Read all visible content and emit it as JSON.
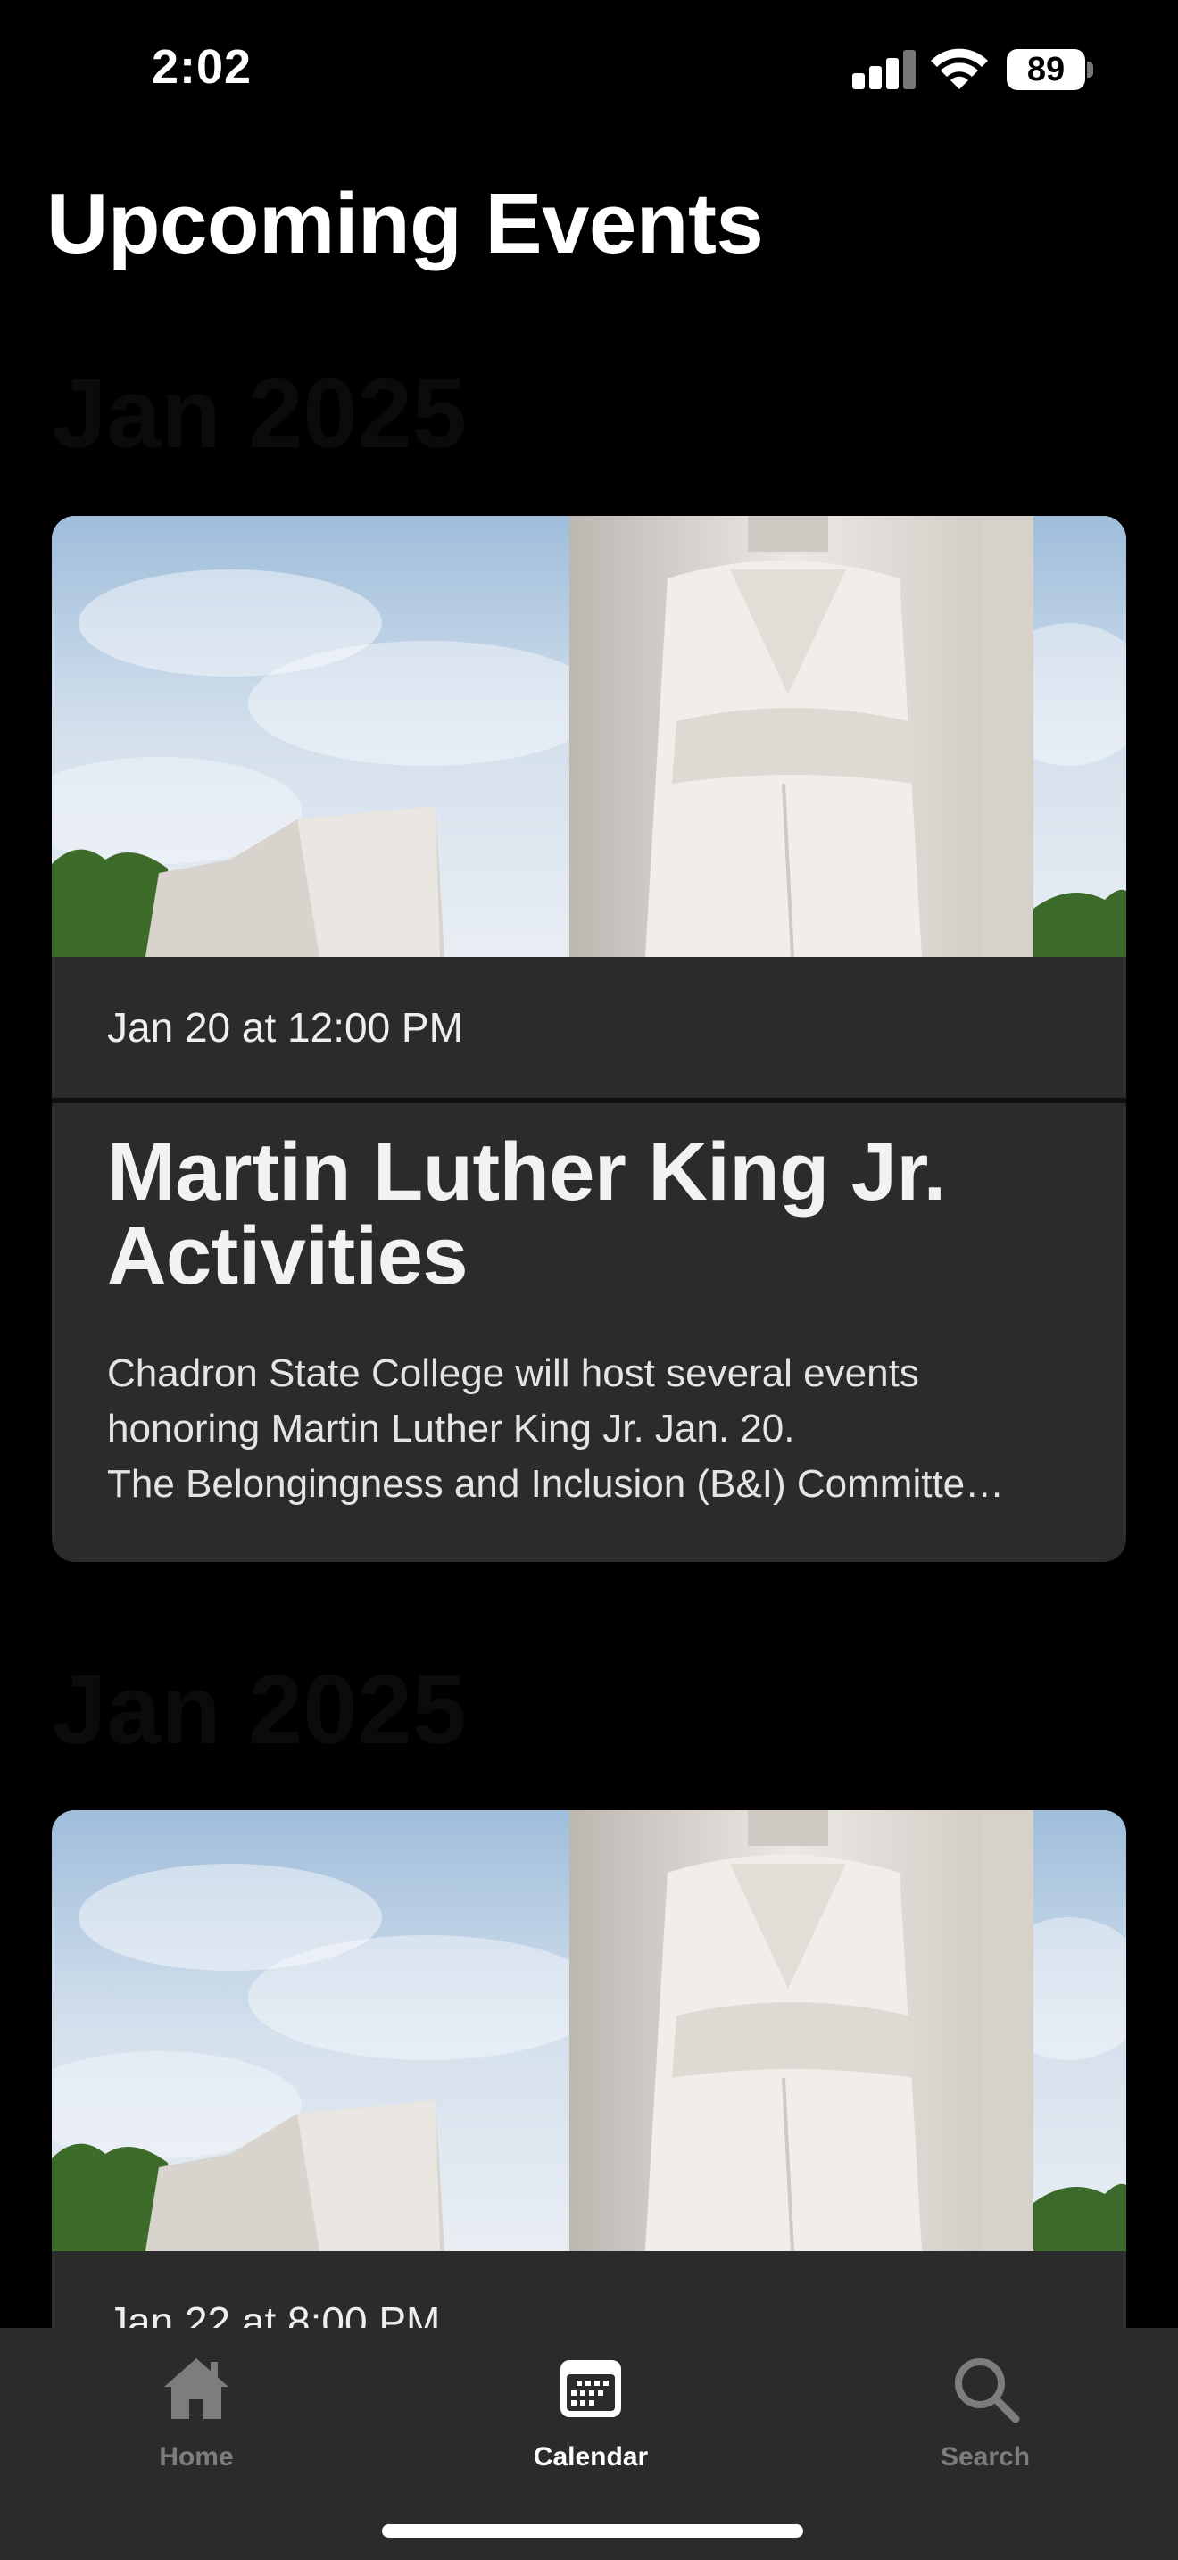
{
  "status_bar": {
    "time": "2:02",
    "battery": "89"
  },
  "header": {
    "title": "Upcoming Events"
  },
  "sections": [
    {
      "month": "Jan 2025"
    },
    {
      "month": "Jan 2025"
    }
  ],
  "events": [
    {
      "date": "Jan 20 at 12:00 PM",
      "title": "Martin Luther King Jr. Activities",
      "description": "Chadron State College will host several events honoring Martin Luther King Jr. Jan. 20.\nThe Belongingness and Inclusion (B&I) Committe…"
    },
    {
      "date": "Jan 22 at 8:00 PM"
    }
  ],
  "tab_bar": {
    "tabs": [
      {
        "label": "Home",
        "icon": "home-icon"
      },
      {
        "label": "Calendar",
        "icon": "calendar-icon",
        "selected": true
      },
      {
        "label": "Search",
        "icon": "search-icon"
      }
    ]
  },
  "colors": {
    "background": "#000000",
    "card": "#2b2b2b",
    "tab_active": "#ffffff",
    "tab_inactive": "#7d7d7d"
  }
}
